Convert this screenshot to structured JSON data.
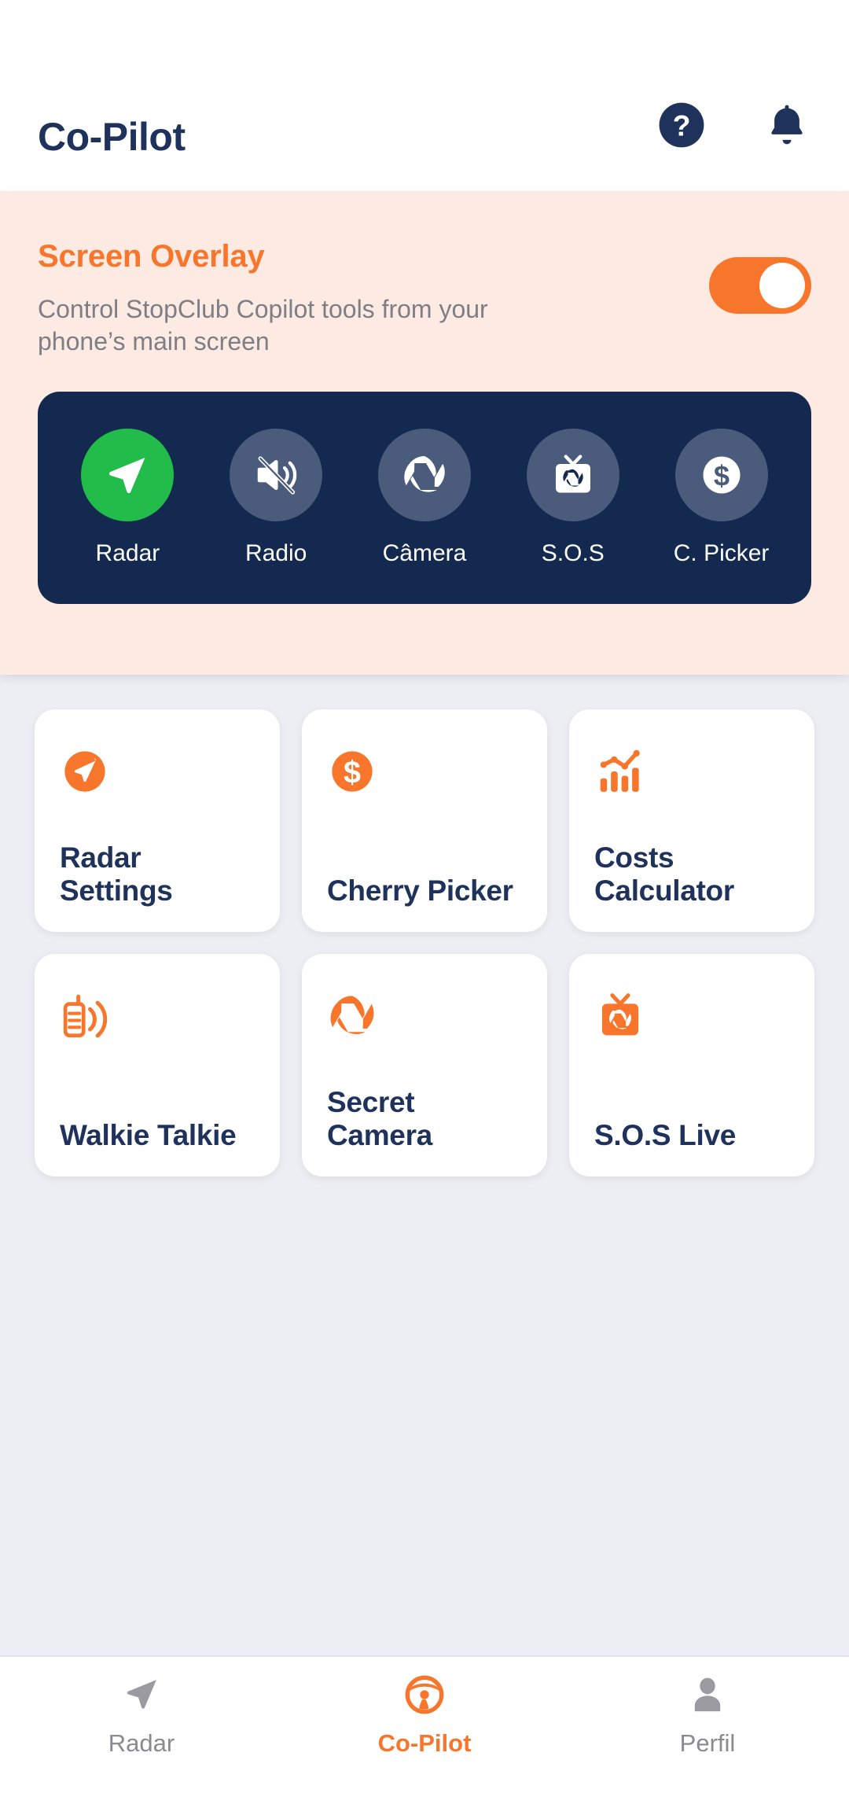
{
  "colors": {
    "accent_orange": "#f8762b",
    "navy": "#1e325c",
    "dark_panel": "#13294f",
    "slate_circle": "#4b5b7b",
    "active_green": "#22bc4b",
    "overlay_bg": "#fdeae2",
    "page_bg": "#eceef3",
    "muted_text": "#8a8a90"
  },
  "header": {
    "title": "Co-Pilot",
    "help_icon": "question-mark-circle-icon",
    "notification_icon": "bell-icon"
  },
  "overlay": {
    "title": "Screen Overlay",
    "subtitle": "Control StopClub Copilot tools from your phone’s main screen",
    "toggle_state": "on",
    "preview_items": [
      {
        "label": "Radar",
        "icon": "navigation-arrow-icon",
        "active": true
      },
      {
        "label": "Radio",
        "icon": "speaker-muted-icon",
        "active": false
      },
      {
        "label": "Câmera",
        "icon": "camera-aperture-icon",
        "active": false
      },
      {
        "label": "S.O.S",
        "icon": "tv-aperture-icon",
        "active": false
      },
      {
        "label": "C. Picker",
        "icon": "dollar-circle-icon",
        "active": false
      }
    ]
  },
  "tools": [
    {
      "label": "Radar Settings",
      "icon": "navigation-arrow-circle-icon"
    },
    {
      "label": "Cherry Picker",
      "icon": "dollar-circle-icon"
    },
    {
      "label": "Costs Calculator",
      "icon": "bar-chart-trend-icon"
    },
    {
      "label": "Walkie Talkie",
      "icon": "walkie-talkie-icon"
    },
    {
      "label": "Secret Camera",
      "icon": "camera-aperture-icon"
    },
    {
      "label": "S.O.S Live",
      "icon": "tv-aperture-icon"
    }
  ],
  "bottom_nav": [
    {
      "label": "Radar",
      "icon": "navigation-arrow-icon",
      "active": false
    },
    {
      "label": "Co-Pilot",
      "icon": "steering-wheel-icon",
      "active": true
    },
    {
      "label": "Perfil",
      "icon": "person-icon",
      "active": false
    }
  ]
}
